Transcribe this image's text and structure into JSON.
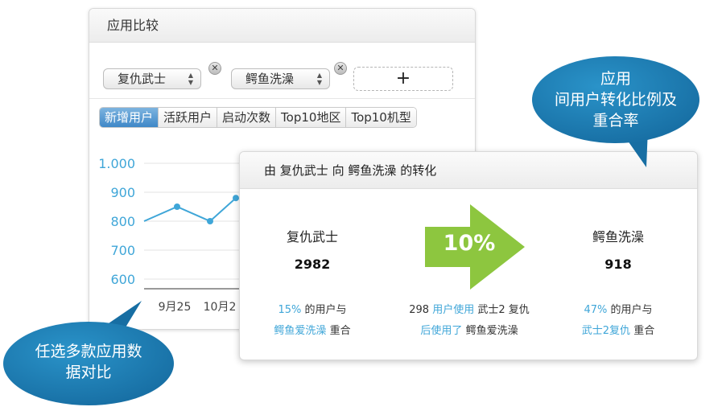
{
  "compare_panel": {
    "title": "应用比较",
    "apps": [
      "复仇武士",
      "鳄鱼洗澡"
    ],
    "add_label": "+",
    "remove_label": "✕",
    "tabs": [
      "新增用户",
      "活跃用户",
      "启动次数",
      "Top10地区",
      "Top10机型"
    ],
    "active_tab": "新增用户"
  },
  "chart_data": {
    "type": "line",
    "y_ticks": [
      "1.000",
      "900",
      "800",
      "700",
      "600"
    ],
    "ylim": [
      600,
      1000
    ],
    "x_ticks": [
      "9月25",
      "10月2"
    ],
    "series": [
      {
        "values": [
          800,
          850,
          800,
          880
        ]
      }
    ],
    "color": "#3fa6d8"
  },
  "conversion_panel": {
    "title_prefix": "由",
    "from_app": "复仇武士",
    "title_middle": "向",
    "to_app": "鳄鱼洗澡",
    "title_suffix": "的转化",
    "left": {
      "name": "复仇武士",
      "count": "2982",
      "note_pct": "15%",
      "note_text1": " 的用户与",
      "note_app": "鳄鱼爱洗澡",
      "note_text2": " 重合"
    },
    "center": {
      "percent": "10%",
      "line1_count": "298 ",
      "line1_hl": "用户使用",
      "line1_app": " 武士2 复仇",
      "line2_hl": "后使用了",
      "line2_app": " 鳄鱼爱洗澡"
    },
    "right": {
      "name": "鳄鱼洗澡",
      "count": "918",
      "note_pct": "47%",
      "note_text1": " 的用户与",
      "note_app": "武士2复仇",
      "note_text2": " 重合"
    }
  },
  "callouts": {
    "top_right": [
      "应用",
      "间用户转化比例及",
      "重合率"
    ],
    "bottom_left": [
      "任选多款应用数",
      "据对比"
    ]
  },
  "colors": {
    "accent_blue": "#3fa6d8",
    "arrow_green": "#8dc63f",
    "callout_blue": "#1e7ab0",
    "tab_active": "#4a8fcc"
  }
}
